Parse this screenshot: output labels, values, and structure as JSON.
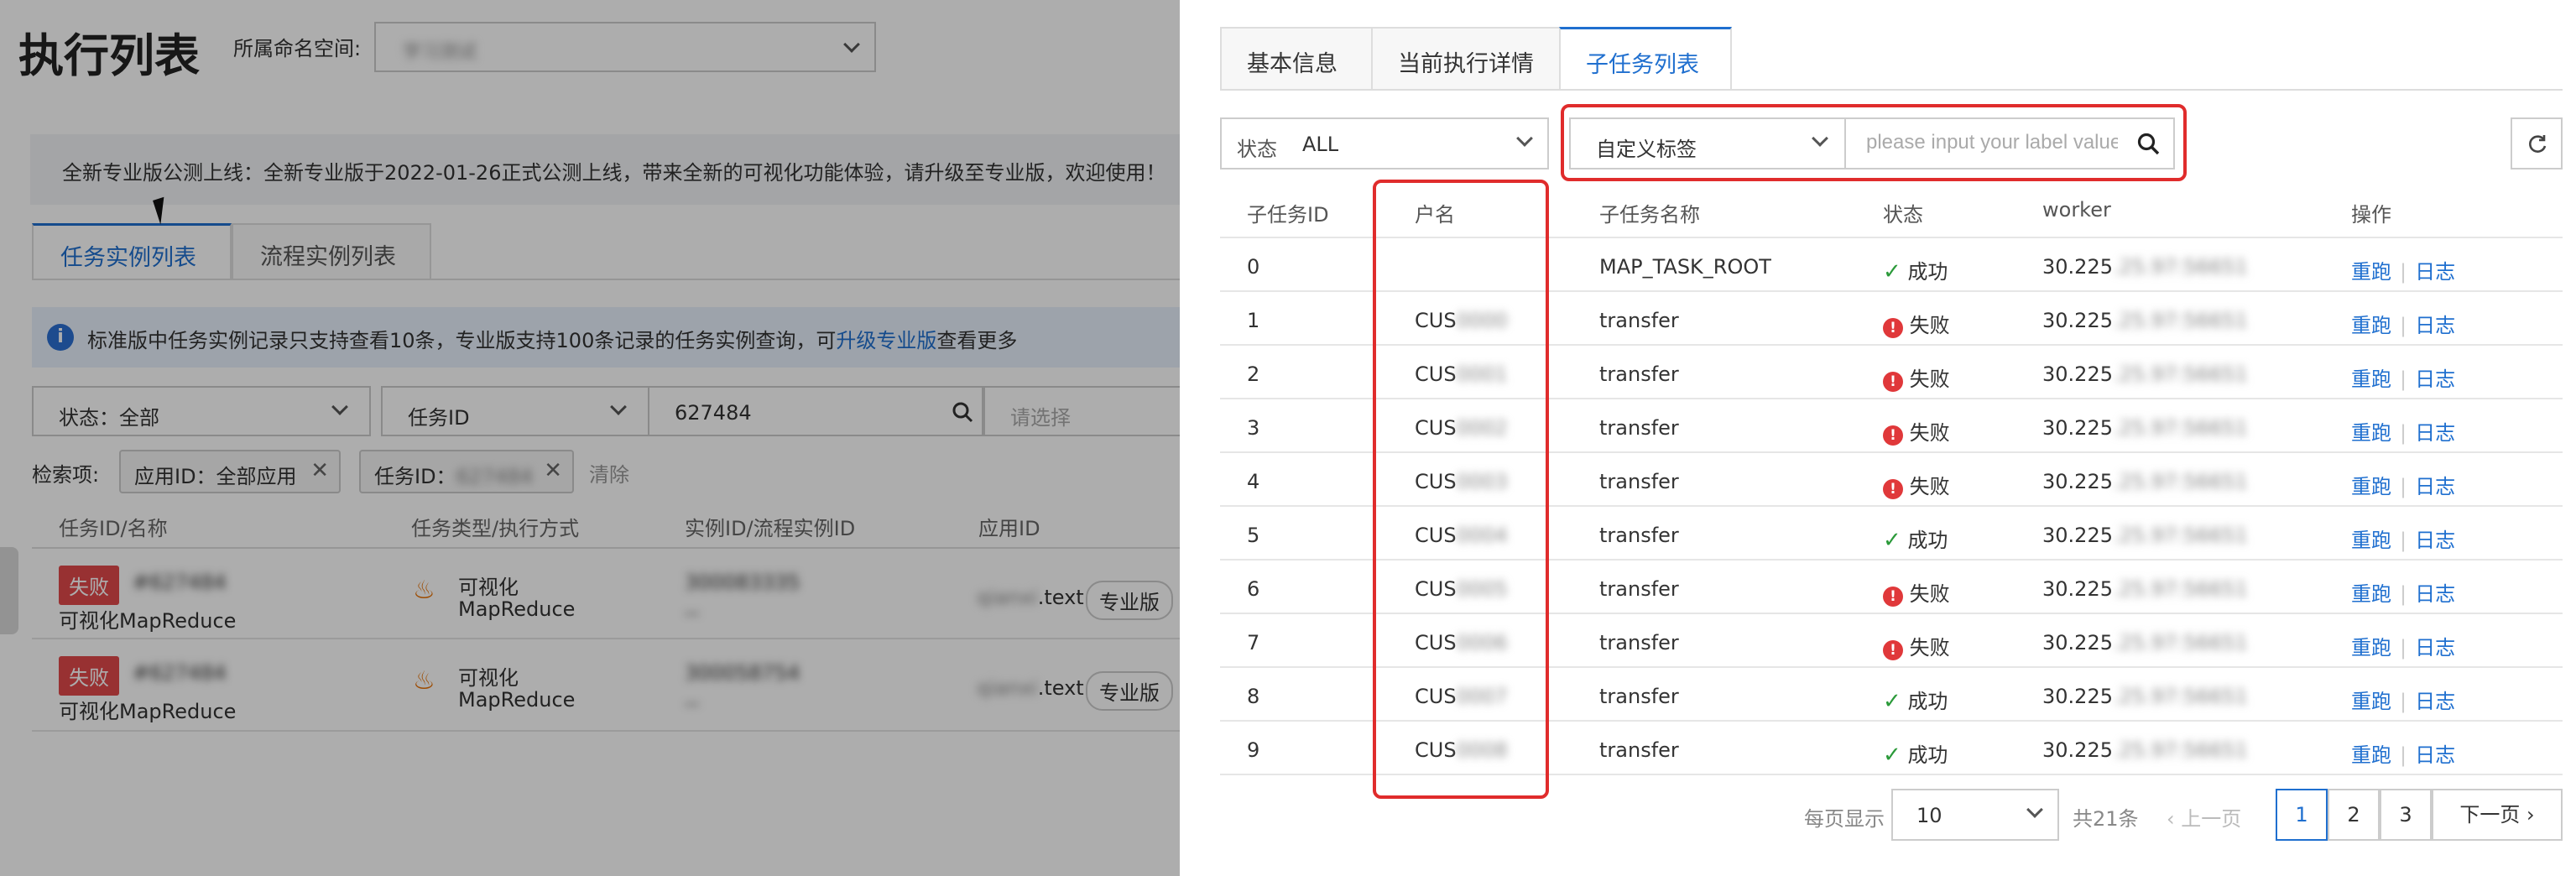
{
  "left": {
    "title": "执行列表",
    "namespace_label": "所属命名空间:",
    "namespace_value": "学习测试",
    "notice": "全新专业版公测上线：全新专业版于2022-01-26正式公测上线，带来全新的可视化功能体验，请升级至专业版，欢迎使用！",
    "tabs": [
      "任务实例列表",
      "流程实例列表"
    ],
    "info_text_1": "标准版中任务实例记录只支持查看10条，专业版支持100条记录的任务实例查询，可",
    "info_link": "升级专业版",
    "info_text_2": "查看更多",
    "filter_status": "状态：全部",
    "filter_task_field": "任务ID",
    "filter_task_value": "627484",
    "filter_placeholder": "请选择",
    "search_terms_label": "检索项:",
    "chip_app": "应用ID：全部应用",
    "chip_task_prefix": "任务ID：",
    "chip_task_value": "627484",
    "clear_label": "清除",
    "headers": [
      "任务ID/名称",
      "任务类型/执行方式",
      "实例ID/流程实例ID",
      "应用ID"
    ],
    "rows": [
      {
        "status": "失败",
        "id": "#627484",
        "name": "可视化MapReduce",
        "type_1": "可视化",
        "type_2": "MapReduce",
        "instance": "300083335",
        "instance_sub": "--",
        "app_prefix": "qianxi",
        "app_suffix": ".text",
        "edition": "专业版"
      },
      {
        "status": "失败",
        "id": "#627484",
        "name": "可视化MapReduce",
        "type_1": "可视化",
        "type_2": "MapReduce",
        "instance": "300058754",
        "instance_sub": "--",
        "app_prefix": "qianxi",
        "app_suffix": ".text",
        "edition": "专业版"
      }
    ]
  },
  "drawer": {
    "tabs": [
      "基本信息",
      "当前执行详情",
      "子任务列表"
    ],
    "status_label": "状态",
    "status_value": "ALL",
    "label_select": "自定义标签",
    "label_placeholder": "please input your label value",
    "headers": [
      "子任务ID",
      "户名",
      "子任务名称",
      "状态",
      "worker",
      "操作"
    ],
    "rows": [
      {
        "id": "0",
        "user_prefix": "",
        "user_masked": "",
        "name": "MAP_TASK_ROOT",
        "ok": true,
        "status": "成功",
        "worker_prefix": "30.225",
        "worker_masked": ".25.97:56651"
      },
      {
        "id": "1",
        "user_prefix": "CUS",
        "user_masked": "0000",
        "name": "transfer",
        "ok": false,
        "status": "失败",
        "worker_prefix": "30.225",
        "worker_masked": ".25.97:56651"
      },
      {
        "id": "2",
        "user_prefix": "CUS",
        "user_masked": "0001",
        "name": "transfer",
        "ok": false,
        "status": "失败",
        "worker_prefix": "30.225",
        "worker_masked": ".25.97:56651"
      },
      {
        "id": "3",
        "user_prefix": "CUS",
        "user_masked": "0002",
        "name": "transfer",
        "ok": false,
        "status": "失败",
        "worker_prefix": "30.225",
        "worker_masked": ".25.97:56651"
      },
      {
        "id": "4",
        "user_prefix": "CUS",
        "user_masked": "0003",
        "name": "transfer",
        "ok": false,
        "status": "失败",
        "worker_prefix": "30.225",
        "worker_masked": ".25.97:56651"
      },
      {
        "id": "5",
        "user_prefix": "CUS",
        "user_masked": "0004",
        "name": "transfer",
        "ok": true,
        "status": "成功",
        "worker_prefix": "30.225",
        "worker_masked": ".25.97:56651"
      },
      {
        "id": "6",
        "user_prefix": "CUS",
        "user_masked": "0005",
        "name": "transfer",
        "ok": false,
        "status": "失败",
        "worker_prefix": "30.225",
        "worker_masked": ".25.97:56651"
      },
      {
        "id": "7",
        "user_prefix": "CUS",
        "user_masked": "0006",
        "name": "transfer",
        "ok": false,
        "status": "失败",
        "worker_prefix": "30.225",
        "worker_masked": ".25.97:56651"
      },
      {
        "id": "8",
        "user_prefix": "CUS",
        "user_masked": "0007",
        "name": "transfer",
        "ok": true,
        "status": "成功",
        "worker_prefix": "30.225",
        "worker_masked": ".25.97:56651"
      },
      {
        "id": "9",
        "user_prefix": "CUS",
        "user_masked": "0008",
        "name": "transfer",
        "ok": true,
        "status": "成功",
        "worker_prefix": "30.225",
        "worker_masked": ".25.97:56651"
      }
    ],
    "action_rerun": "重跑",
    "action_log": "日志",
    "pagination": {
      "per_page_label": "每页显示",
      "per_page_value": "10",
      "total": "共21条",
      "prev": "上一页",
      "pages": [
        "1",
        "2",
        "3"
      ],
      "current": "1",
      "next": "下一页"
    },
    "highlight_color": "#e02c2c",
    "accent_color": "#1f6fcf"
  }
}
